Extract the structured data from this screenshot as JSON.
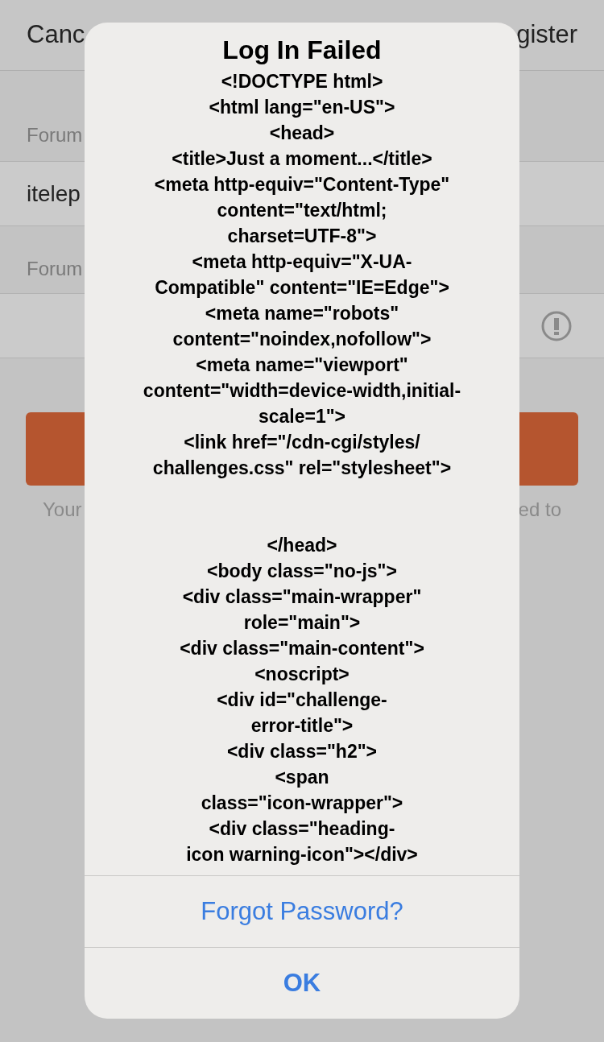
{
  "background": {
    "nav_left": "Canc",
    "nav_right": "gister",
    "sections": [
      {
        "label": "Forum",
        "field_value": "itelep",
        "kind": "text"
      },
      {
        "label": "Forum",
        "kind": "secure"
      }
    ],
    "note_left": "Your",
    "note_right": "ed to"
  },
  "alert": {
    "title": "Log In Failed",
    "message_blocks": [
      [
        "<!DOCTYPE html>",
        "<html lang=\"en-US\">",
        "<head>",
        "<title>Just a moment...</title>",
        "<meta http-equiv=\"Content-Type\"",
        "content=\"text/html;",
        "charset=UTF-8\">",
        "<meta http-equiv=\"X-UA-",
        "Compatible\" content=\"IE=Edge\">",
        "<meta name=\"robots\"",
        "content=\"noindex,nofollow\">",
        "<meta name=\"viewport\"",
        "content=\"width=device-width,initial-",
        "scale=1\">",
        "<link href=\"/cdn-cgi/styles/",
        "challenges.css\" rel=\"stylesheet\">"
      ],
      [
        "</head>",
        "<body class=\"no-js\">",
        "<div class=\"main-wrapper\"",
        "role=\"main\">",
        "<div class=\"main-content\">",
        "<noscript>",
        "<div id=\"challenge-",
        "error-title\">",
        "<div class=\"h2\">",
        "<span",
        "class=\"icon-wrapper\">",
        "<div class=\"heading-",
        "icon warning-icon\"></div>"
      ]
    ],
    "buttons": [
      {
        "label": "Forgot Password?",
        "bold": false
      },
      {
        "label": "OK",
        "bold": true
      }
    ]
  }
}
